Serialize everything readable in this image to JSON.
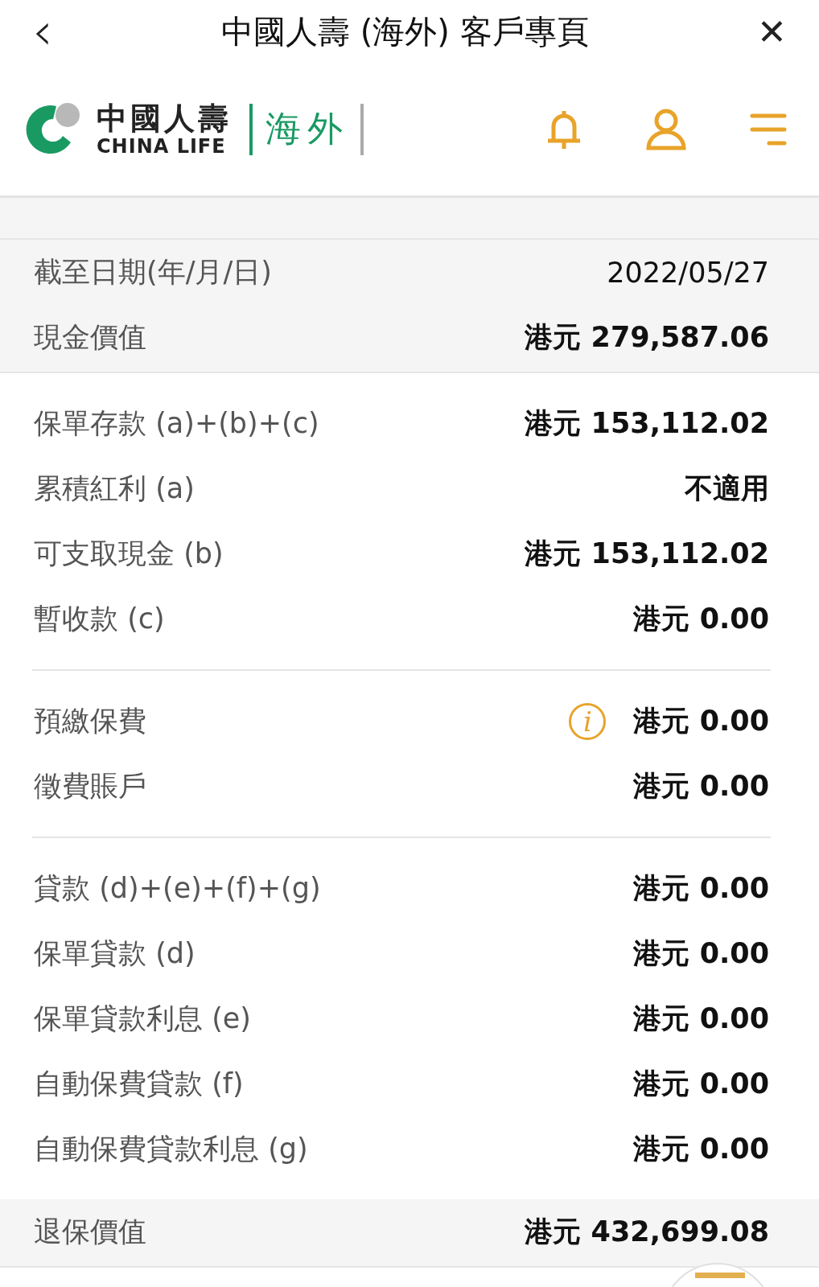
{
  "top_bar": {
    "back": "‹",
    "title": "中國人壽 (海外) 客戶專頁",
    "close": "✕"
  },
  "header": {
    "brand_chinese": "中國人壽",
    "brand_english": "CHINA LIFE",
    "region": "海外"
  },
  "sections": [
    {
      "shaded": true,
      "rows": [
        {
          "label": "截至日期(年/月/日)",
          "value": "2022/05/27",
          "bold": false
        },
        {
          "label": "現金價值",
          "value": "港元 279,587.06",
          "bold": true
        }
      ]
    },
    {
      "shaded": false,
      "rows": [
        {
          "label": "保單存款 (a)+(b)+(c)",
          "value": "港元 153,112.02",
          "bold": true
        },
        {
          "label": "累積紅利 (a)",
          "value": "不適用",
          "bold": true
        },
        {
          "label": "可支取現金 (b)",
          "value": "港元 153,112.02",
          "bold": true
        },
        {
          "label": "暫收款 (c)",
          "value": "港元 0.00",
          "bold": true
        }
      ]
    },
    {
      "shaded": false,
      "rows": [
        {
          "label": "預繳保費",
          "value": "港元 0.00",
          "bold": true,
          "info": "i"
        },
        {
          "label": "徵費賬戶",
          "value": "港元 0.00",
          "bold": true
        }
      ]
    },
    {
      "shaded": false,
      "rows": [
        {
          "label": "貸款 (d)+(e)+(f)+(g)",
          "value": "港元 0.00",
          "bold": true
        },
        {
          "label": "保單貸款 (d)",
          "value": "港元 0.00",
          "bold": true
        },
        {
          "label": "保單貸款利息 (e)",
          "value": "港元 0.00",
          "bold": true
        },
        {
          "label": "自動保費貸款 (f)",
          "value": "港元 0.00",
          "bold": true
        },
        {
          "label": "自動保費貸款利息 (g)",
          "value": "港元 0.00",
          "bold": true
        }
      ]
    },
    {
      "shaded": true,
      "rows": [
        {
          "label": "退保價值",
          "value": "港元 432,699.08",
          "bold": true
        }
      ]
    }
  ]
}
